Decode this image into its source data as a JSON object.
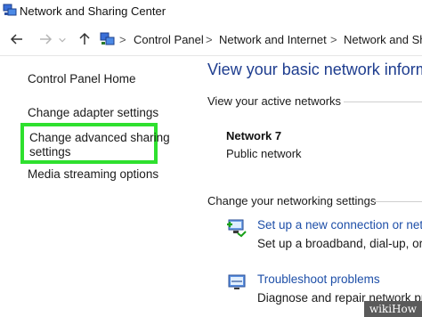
{
  "window": {
    "title": "Network and Sharing Center",
    "icon": "network-center-icon"
  },
  "nav": {
    "back_icon": "arrow-left-icon",
    "forward_icon": "arrow-right-icon",
    "up_icon": "arrow-up-icon",
    "breadcrumb": [
      "Control Panel",
      "Network and Internet",
      "Network and Sh"
    ],
    "separator": ">"
  },
  "sidebar": {
    "home": "Control Panel Home",
    "items": [
      {
        "label": "Change adapter settings"
      },
      {
        "label_line1": "Change advanced sharing",
        "label_line2": "settings",
        "highlighted": true,
        "highlight_color": "#2ee02e"
      },
      {
        "label": "Media streaming options"
      }
    ]
  },
  "main": {
    "title": "View your basic network informa",
    "active_networks_label": "View your active networks",
    "network": {
      "name": "Network 7",
      "type": "Public network"
    },
    "change_settings_label": "Change your networking settings",
    "tasks": [
      {
        "icon": "new-connection-icon",
        "link": "Set up a new connection or netwo",
        "desc": "Set up a broadband, dial-up, or"
      },
      {
        "icon": "troubleshoot-icon",
        "link": "Troubleshoot problems",
        "desc": "Diagnose and repair network pro"
      }
    ]
  },
  "watermark": "wikiHow",
  "colors": {
    "link": "#1e4fa8",
    "title": "#1e3d8f",
    "highlight": "#2ee02e"
  }
}
